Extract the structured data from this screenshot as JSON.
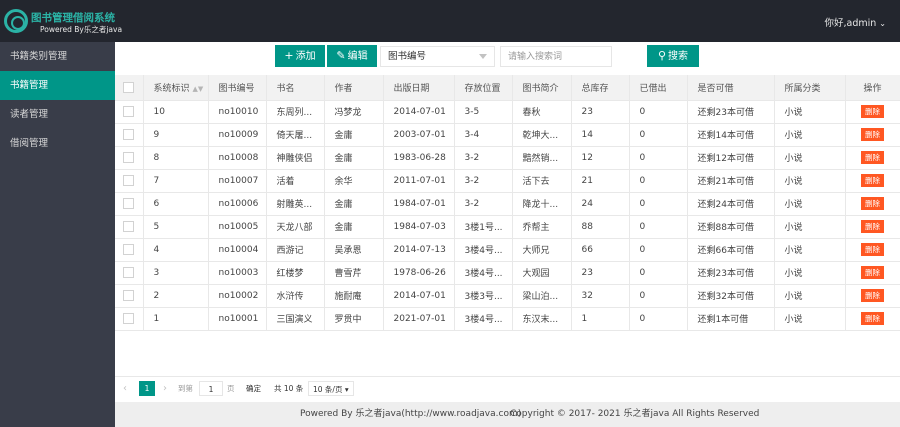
{
  "header": {
    "title": "图书管理借阅系统",
    "subtitle": "Powered By乐之者java",
    "user": "你好,admin"
  },
  "sidebar": {
    "items": [
      {
        "label": "书籍类别管理",
        "active": false
      },
      {
        "label": "书籍管理",
        "active": true
      },
      {
        "label": "读者管理",
        "active": false
      },
      {
        "label": "借阅管理",
        "active": false
      }
    ]
  },
  "toolbar": {
    "add_label": "添加",
    "edit_label": "编辑",
    "field_select": "图书编号",
    "search_placeholder": "请输入搜索词",
    "search_label": "搜索"
  },
  "table": {
    "headers": [
      "系统标识",
      "图书编号",
      "书名",
      "作者",
      "出版日期",
      "存放位置",
      "图书简介",
      "总库存",
      "已借出",
      "是否可借",
      "所属分类",
      "操作"
    ],
    "delete_label": "删除",
    "rows": [
      [
        "10",
        "no10010",
        "东周列...",
        "冯梦龙",
        "2014-07-01",
        "3-5",
        "春秋",
        "23",
        "0",
        "还剩23本可借",
        "小说"
      ],
      [
        "9",
        "no10009",
        "倚天屠...",
        "金庸",
        "2003-07-01",
        "3-4",
        "乾坤大...",
        "14",
        "0",
        "还剩14本可借",
        "小说"
      ],
      [
        "8",
        "no10008",
        "神雕侠侣",
        "金庸",
        "1983-06-28",
        "3-2",
        "黯然销...",
        "12",
        "0",
        "还剩12本可借",
        "小说"
      ],
      [
        "7",
        "no10007",
        "活着",
        "余华",
        "2011-07-01",
        "3-2",
        "活下去",
        "21",
        "0",
        "还剩21本可借",
        "小说"
      ],
      [
        "6",
        "no10006",
        "射雕英...",
        "金庸",
        "1984-07-01",
        "3-2",
        "降龙十...",
        "24",
        "0",
        "还剩24本可借",
        "小说"
      ],
      [
        "5",
        "no10005",
        "天龙八部",
        "金庸",
        "1984-07-03",
        "3楼1号...",
        "乔帮主",
        "88",
        "0",
        "还剩88本可借",
        "小说"
      ],
      [
        "4",
        "no10004",
        "西游记",
        "吴承恩",
        "2014-07-13",
        "3楼4号...",
        "大师兄",
        "66",
        "0",
        "还剩66本可借",
        "小说"
      ],
      [
        "3",
        "no10003",
        "红楼梦",
        "曹雪芹",
        "1978-06-26",
        "3楼4号...",
        "大观园",
        "23",
        "0",
        "还剩23本可借",
        "小说"
      ],
      [
        "2",
        "no10002",
        "水浒传",
        "施耐庵",
        "2014-07-01",
        "3楼3号...",
        "梁山泊...",
        "32",
        "0",
        "还剩32本可借",
        "小说"
      ],
      [
        "1",
        "no10001",
        "三国演义",
        "罗贯中",
        "2021-07-01",
        "3楼4号...",
        "东汉末...",
        "1",
        "0",
        "还剩1本可借",
        "小说"
      ]
    ]
  },
  "pager": {
    "current_page": "1",
    "goto_label": "到第",
    "goto_value": "1",
    "page_unit": "页",
    "confirm_label": "确定",
    "total_label": "共 10 条",
    "page_size_label": "10 条/页"
  },
  "footer": {
    "powered": "Powered By 乐之者java(http://www.roadjava.com)",
    "copyright": "Copyright © 2017- 2021 乐之者java All Rights Reserved"
  },
  "colors": {
    "accent": "#009688",
    "topbar": "#23262e",
    "sidebar": "#393d49",
    "danger": "#ff5722",
    "logo": "#2bb3a6"
  }
}
